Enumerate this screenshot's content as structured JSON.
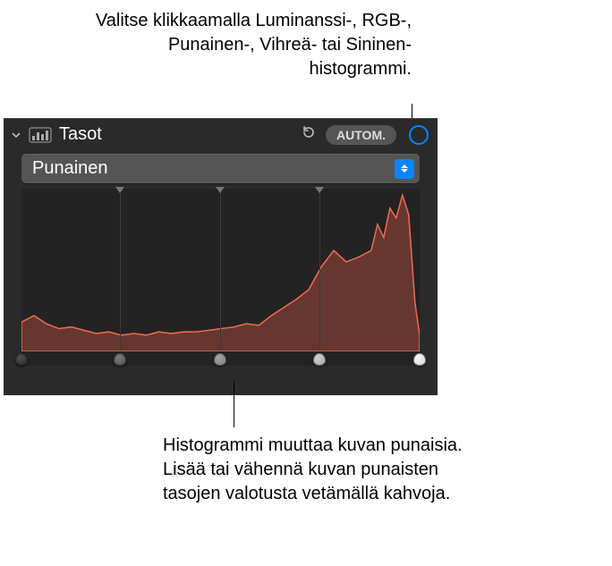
{
  "callouts": {
    "top": "Valitse klikkaamalla Luminanssi-, RGB-, Punainen-, Vihreä- tai Sininen-histogrammi.",
    "bottom": "Histogrammi muuttaa kuvan punaisia. Lisää tai vähennä kuvan punaisten tasojen valotusta vetämällä kahvoja."
  },
  "panel": {
    "title": "Tasot",
    "auto_label": "AUTOM.",
    "dropdown": {
      "selected": "Punainen"
    }
  },
  "chart_data": {
    "type": "area",
    "xlabel": "",
    "ylabel": "",
    "xlim": [
      0,
      255
    ],
    "ylim": [
      0,
      100
    ],
    "handles_x": [
      0,
      63,
      127,
      191,
      255
    ],
    "series": [
      {
        "name": "Punainen",
        "color": "#d95b4a",
        "x": [
          0,
          8,
          16,
          24,
          32,
          40,
          48,
          56,
          64,
          72,
          80,
          88,
          96,
          104,
          112,
          120,
          128,
          136,
          144,
          152,
          160,
          168,
          176,
          184,
          192,
          200,
          208,
          216,
          224,
          228,
          232,
          236,
          240,
          244,
          248,
          252,
          255
        ],
        "values": [
          18,
          22,
          17,
          14,
          15,
          13,
          11,
          12,
          10,
          11,
          10,
          12,
          11,
          12,
          12,
          13,
          14,
          15,
          17,
          16,
          22,
          27,
          32,
          38,
          52,
          62,
          55,
          58,
          62,
          78,
          70,
          88,
          82,
          96,
          84,
          30,
          10
        ]
      }
    ]
  }
}
